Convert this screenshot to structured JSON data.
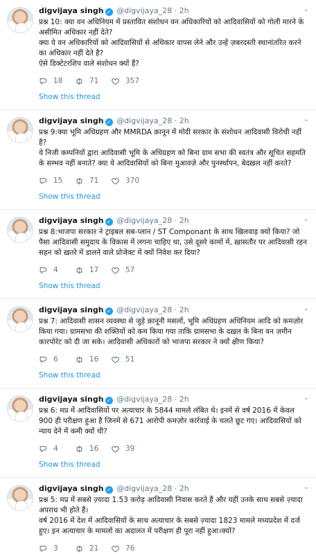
{
  "tweets": [
    {
      "name": "digvijaya singh",
      "handle": "@digvijaya_28",
      "time": "2h",
      "lines": [
        "प्रश्न 10: क्या वन अधिनियम में प्रस्तावित संशोधन वन अधिकारियों को आदिवासियों को गोली मारने के असीमित अधिकार नहीं देते?",
        "क्या ये वन अधिकारियों को आदिवासियों से अधिकार वापस लेने और उन्हें ज़बरदस्ती स्थानांतरित करने का अधिकार नहीं देते है?",
        "ऐसे डिक्टेटरशिप वाले संशोधन क्यों हैं?"
      ],
      "replies": "18",
      "retweets": "71",
      "likes": "357",
      "show": "Show this thread"
    },
    {
      "name": "digvijaya singh",
      "handle": "@digvijaya_28",
      "time": "2h",
      "lines": [
        "प्रश्न 9:क्या भूमि अधिग्रहण और MMRDA क़ानून में मोदी सरकार के संशोधन आदिवासी विरोधी नहीं है?",
        "ये निजी कम्पनियों द्वारा आदिवासी भूमि के अधिग्रहण को बिना ग्राम सभा की स्वतंत्र और सूचित सहमति के सम्भव नहीं बनाते? क्या ये आदिवासियों को बिना मुआवज़े और पुनर्स्थापन, बेदख़ल नहीं करते?"
      ],
      "replies": "15",
      "retweets": "71",
      "likes": "370",
      "show": "Show this thread"
    },
    {
      "name": "digvijaya singh",
      "handle": "@digvijaya_28",
      "time": "2h",
      "lines": [
        "प्रश्न 8:भाजपा सरकार ने ट्राइबल सब-प्लान / ST Componant के साथ खिलवाड़ क्यों किया? जो पैसा आदिवासी समुदाय के विकास में लगना चाहिए था, उसे दूसरे कामों में, ख़ासतौर पर आदिवासी रहन सहन को ख़तरे में डालने वाले प्रोजेक्ट में क्यों निवेश कर दिया?"
      ],
      "replies": "4",
      "retweets": "17",
      "likes": "57",
      "show": "Show this thread"
    },
    {
      "name": "digvijaya singh",
      "handle": "@digvijaya_28",
      "time": "2h",
      "lines": [
        "प्रश्न 7: आदिवासी शासन व्यवस्था से जुड़े क़ानूनी मसलों, भूमि अधिग्रहण अधिनियम आदि को कमज़ोर किया गया। ग्रामसभा की शक्तियों को कम किया गया ताकि ग्रामसभा के दख़ल के बिना वन ज़मीन कारपोरेट को दी जा सके। आदिवासी अधिकारों को भाजपा सरकार ने क्यों क्षीण किया?"
      ],
      "replies": "6",
      "retweets": "16",
      "likes": "51",
      "show": "Show this thread"
    },
    {
      "name": "digvijaya singh",
      "handle": "@digvijaya_28",
      "time": "2h",
      "lines": [
        "प्रश्न 6: मप्र में आदिवासियों पर अत्याचार के 5844 मामले लंबित थे। इनमें से वर्ष 2016 में केवल 900 ही परीक्षण हुआ है जिनमें से 671 आरोपी कमज़ोर कार्रवाई के चलते छूट गए। आदिवासियों को न्याय देने में कमी क्यों थी?"
      ],
      "replies": "4",
      "retweets": "16",
      "likes": "39",
      "show": "Show this thread"
    },
    {
      "name": "digvijaya singh",
      "handle": "@digvijaya_28",
      "time": "2h",
      "lines": [
        "प्रश्न 5: मप्र में सबसे ज़्यादा 1.53 करोड़ आदिवासी निवास करते हैं और यहीं उनके साथ सबसे ज़्यादा अपराध भी होते हैं।",
        "वर्ष 2016 में देश में आदिवासियों के साथ अत्याचार के सबसे ज़्यादा 1823 मामले मध्यप्रदेश में दर्ज हुए। इन अत्याचार के मामलों का अदालत में परीक्षण ही पूरा नहीं हुआ।क्यों?"
      ],
      "replies": "3",
      "retweets": "21",
      "likes": "76",
      "show": ""
    }
  ],
  "icons": {
    "reply": "reply-icon",
    "retweet": "retweet-icon",
    "like": "heart-icon",
    "verified": "verified-badge-icon",
    "caret": "chevron-down-icon"
  },
  "colors": {
    "link": "#1b95e0",
    "verified": "#1da1f2",
    "muted": "#657786"
  }
}
